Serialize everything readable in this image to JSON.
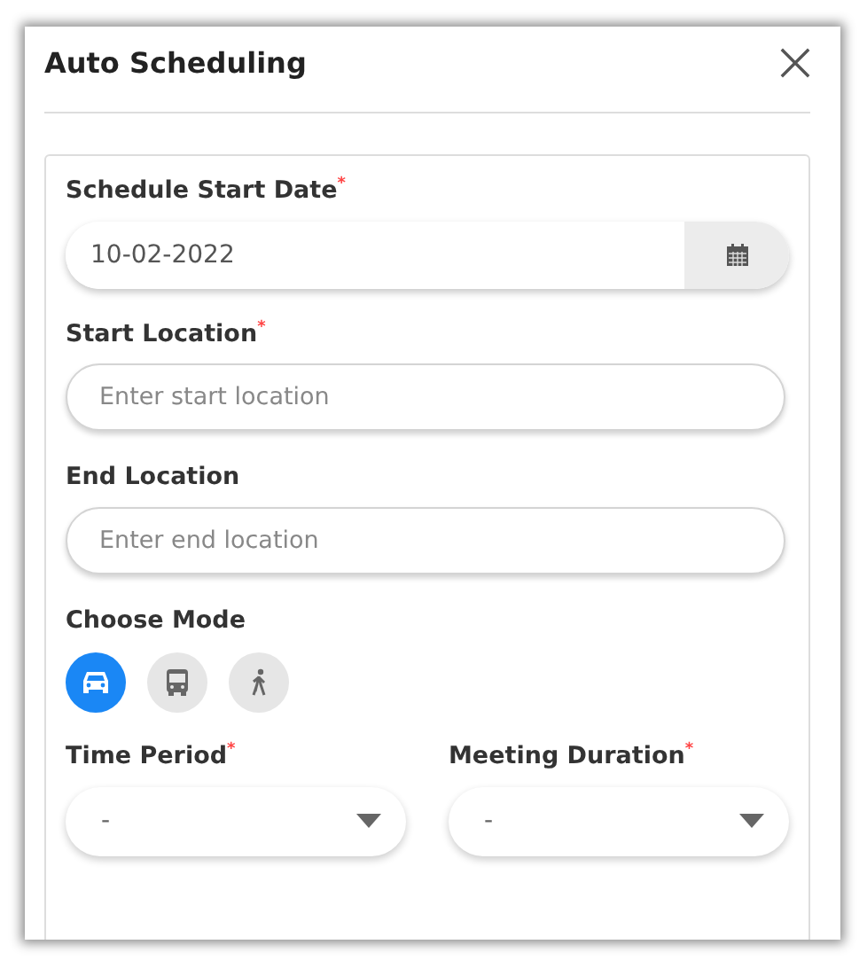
{
  "dialog": {
    "title": "Auto Scheduling"
  },
  "date_field": {
    "label": "Schedule Start Date$^{*}$",
    "value": "10-02-2022"
  },
  "start_location": {
    "label": "Start Location$^{*}$",
    "placeholder": "Enter start location"
  },
  "end_location": {
    "label": "End Location",
    "placeholder": "Enter end location"
  },
  "mode": {
    "label": "Choose Mode",
    "options": [
      {
        "kind": "car",
        "selected": true
      },
      {
        "kind": "bus",
        "selected": false
      },
      {
        "kind": "walk",
        "selected": false
      }
    ]
  },
  "selects": [
    {
      "label": "Time Period$^{*}$",
      "value": "-"
    },
    {
      "label": "Meeting Duration$^{*}$",
      "value": "-"
    }
  ]
}
